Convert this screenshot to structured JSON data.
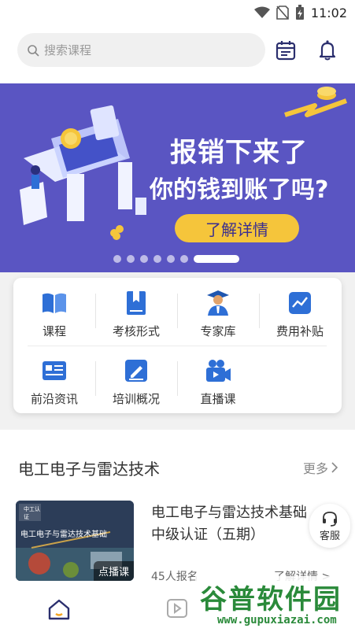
{
  "status": {
    "time": "11:02"
  },
  "search": {
    "placeholder": "搜索课程"
  },
  "banner": {
    "headline": "报销下来了",
    "subheadline": "你的钱到账了吗?",
    "button": "了解详情",
    "page_count": 7,
    "active_page": 7
  },
  "menu": [
    {
      "label": "课程",
      "icon": "book-open-icon"
    },
    {
      "label": "考核形式",
      "icon": "bookmark-book-icon"
    },
    {
      "label": "专家库",
      "icon": "expert-icon"
    },
    {
      "label": "费用补贴",
      "icon": "trend-chart-icon"
    },
    {
      "label": "前沿资讯",
      "icon": "news-icon"
    },
    {
      "label": "培训概况",
      "icon": "edit-icon"
    },
    {
      "label": "直播课",
      "icon": "video-camera-icon"
    }
  ],
  "section": {
    "title": "电工电子与雷达技术",
    "more": "更多"
  },
  "course": {
    "title": "电工电子与雷达技术基础 中级认证（五期）",
    "thumb_org": "中工认证",
    "thumb_name": "电工电子与雷达技术基础",
    "tag": "点播课",
    "enrolled": "45人报名",
    "link": "了解详情 >"
  },
  "support": {
    "label": "客服"
  },
  "watermark": {
    "name": "谷普软件园",
    "url": "www.gupuxiazai.com"
  },
  "colors": {
    "banner_bg": "#5a55c2",
    "accent_yellow": "#f5c53b",
    "icon_blue": "#2e6fd6"
  }
}
